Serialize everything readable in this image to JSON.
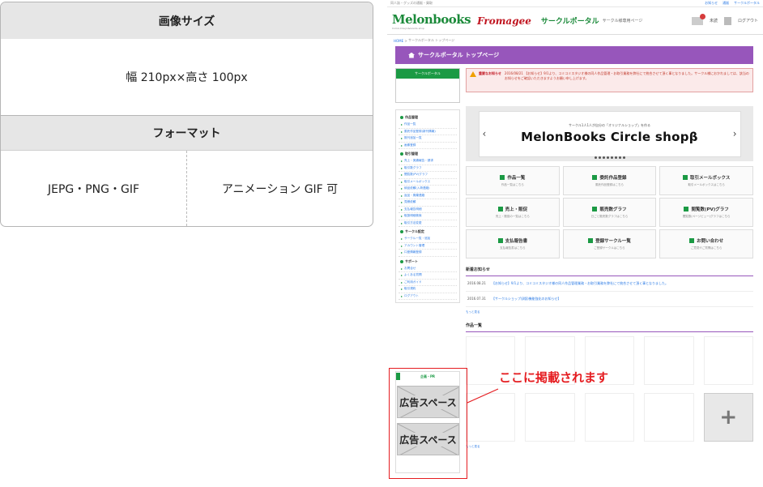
{
  "spec": {
    "size_header": "画像サイズ",
    "size_value": "幅 210px×高さ 100px",
    "format_header": "フォーマット",
    "format_static": "JEPG・PNG・GIF",
    "format_anim": "アニメーション GIF 可"
  },
  "site": {
    "topbar_text": "同人誌・グッズの通販・買取",
    "topbar_links": [
      "お知らせ",
      "通販",
      "サークルポータル"
    ],
    "logo_main": "Melonbooks",
    "logo_sub": "Comic,Doujin&Goods shop",
    "logo_second": "Fromagee",
    "portal_title": "サークルポータル",
    "portal_sub": "サークル様専用ページ",
    "mail_label": "未読",
    "logout_label": "ログアウト",
    "breadcrumb_home": "HOME",
    "breadcrumb_current": "サークルポータル トップページ",
    "page_title": "サークルポータル トップページ",
    "side_head": "サークルポータル",
    "sections": [
      {
        "title": "作品管理",
        "items": [
          "作品一覧",
          "委託作品登録(新刊情報)",
          "既刊追加一覧",
          "画像登録"
        ]
      },
      {
        "title": "取引管理",
        "items": [
          "売上・実績報告・請求",
          "取引数グラフ",
          "閲覧数(PV)グラフ",
          "取引メールボックス",
          "納品依頼(入荷連絡)",
          "返品・廃棄連絡",
          "見積依頼",
          "支払報告明細",
          "取扱明細検索",
          "取引方法変更"
        ]
      },
      {
        "title": "サークル設定",
        "items": [
          "サークル一覧・追加",
          "アカウント管理",
          "口座情報登録"
        ]
      },
      {
        "title": "サポート",
        "items": [
          "お問合せ",
          "よくある質問",
          "ご利用ガイド",
          "取引規約",
          "ログアウト"
        ]
      }
    ],
    "alert_title": "重要なお知らせ",
    "alert_text": "2016/08/21 【お知らせ】9/1より、コミコミスタジオ様の同人作品管理・お取引業務を弊社にて統合させて頂く事となりました。サークル様におかれましては、該当のお知らせをご確認いただきますようお願い申し上げます。",
    "banner_small": "サークル1人1人が自分の「オリジナルショップ」を作る",
    "banner_big": "MelonBooks Circle shopβ",
    "tiles": [
      {
        "title": "作品一覧",
        "sub": "作品一覧はこちら"
      },
      {
        "title": "委託作品登録",
        "sub": "委託作品登録はこちら"
      },
      {
        "title": "取引メールボックス",
        "sub": "取引メールボックスはこちら"
      },
      {
        "title": "売上・販促",
        "sub": "売上・販促の一覧はこちら"
      },
      {
        "title": "販売数グラフ",
        "sub": "日ごと販売数グラフはこちら"
      },
      {
        "title": "閲覧数(PV)グラフ",
        "sub": "閲覧数(ページビュー)グラフはこちら"
      },
      {
        "title": "支払報告書",
        "sub": "支払報告書はこちら"
      },
      {
        "title": "登録サークル一覧",
        "sub": "ご登録サークルはこちら"
      },
      {
        "title": "お問い合わせ",
        "sub": "ご意見やご質問はこちら"
      }
    ],
    "news_title": "新着お知らせ",
    "news": [
      {
        "date": "2016.08.21",
        "text": "【お知らせ】9/1より、コミコミスタジオ様の同人作品管理業務・お取引業務を弊社にて統合させて頂く事となりました。"
      },
      {
        "date": "2016.07.31",
        "text": "【サークルショップ(β版)機能強化のお知らせ】"
      }
    ],
    "more_label": "もっと見る",
    "works_title": "作品一覧",
    "plus_label": "+",
    "ad_head": "企画・PR",
    "ad_label": "広告スペース",
    "callout": "ここに掲載されます"
  }
}
